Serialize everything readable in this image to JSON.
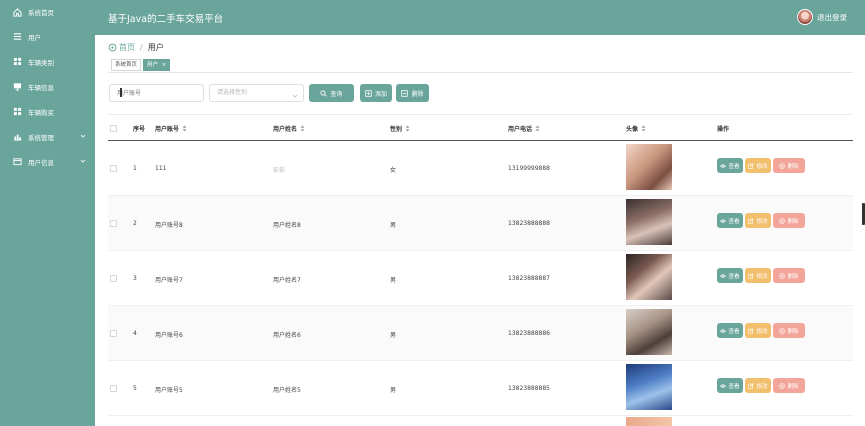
{
  "sidebar": {
    "items": [
      {
        "label": "系统首页",
        "icon": "home-icon"
      },
      {
        "label": "用户",
        "icon": "list-icon"
      },
      {
        "label": "车辆类别",
        "icon": "grid-icon"
      },
      {
        "label": "车辆信息",
        "icon": "monitor-icon"
      },
      {
        "label": "车辆购买",
        "icon": "grid-icon"
      },
      {
        "label": "系统管理",
        "icon": "chart-icon"
      },
      {
        "label": "用户信息",
        "icon": "card-icon"
      }
    ]
  },
  "header": {
    "title": "基于Java的二手车交易平台",
    "logout": "退出登录"
  },
  "breadcrumb": {
    "home": "首页",
    "separator": "/",
    "current": "用户"
  },
  "tags": [
    "系统首页",
    "用户"
  ],
  "search": {
    "account_placeholder": "用户账号",
    "gender_placeholder": "请选择性别",
    "query_label": "查询",
    "add_label": "添加",
    "delete_label": "删除"
  },
  "table": {
    "columns": [
      "序号",
      "用户账号",
      "用户姓名",
      "性别",
      "用户电话",
      "头像",
      "操作"
    ],
    "rows": [
      {
        "index": "1",
        "account": "111",
        "name": "彭彭",
        "gender": "女",
        "phone": "13199999888"
      },
      {
        "index": "2",
        "account": "用户账号8",
        "name": "用户姓名8",
        "gender": "男",
        "phone": "13823888888"
      },
      {
        "index": "3",
        "account": "用户账号7",
        "name": "用户姓名7",
        "gender": "男",
        "phone": "13823888887"
      },
      {
        "index": "4",
        "account": "用户账号6",
        "name": "用户姓名6",
        "gender": "男",
        "phone": "13823888886"
      },
      {
        "index": "5",
        "account": "用户账号5",
        "name": "用户姓名5",
        "gender": "男",
        "phone": "13823888885"
      }
    ],
    "actions": {
      "view": "查看",
      "edit": "修改",
      "delete": "删除"
    }
  },
  "colors": {
    "primary": "#6aa59b",
    "warning": "#f2bf6d",
    "danger": "#f3a59a"
  }
}
